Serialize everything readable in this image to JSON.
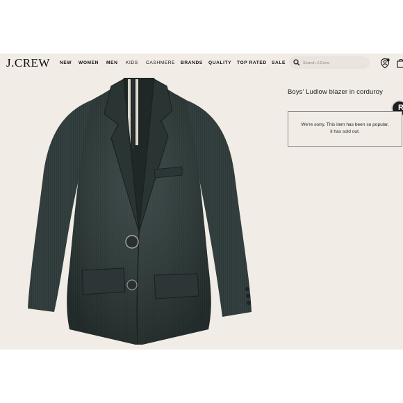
{
  "brand": {
    "logo": "J.CREW"
  },
  "nav": {
    "items": [
      {
        "label": "NEW"
      },
      {
        "label": "WOMEN"
      },
      {
        "label": "MEN"
      },
      {
        "label": "KIDS"
      },
      {
        "label": "CASHMERE"
      },
      {
        "label": "BRANDS"
      },
      {
        "label": "QUALITY"
      },
      {
        "label": "TOP RATED"
      },
      {
        "label": "SALE"
      }
    ]
  },
  "search": {
    "placeholder": "Search J.Crew",
    "value": ""
  },
  "icons": {
    "search": "search-icon",
    "account": "user-icon",
    "bag": "shopping-bag-icon"
  },
  "product": {
    "title": "Boys' Ludlow blazer in corduroy",
    "soldout_line1": "We're sorry. This item has been so popular,",
    "soldout_line2": "it has sold out.",
    "badge": "R",
    "image_description_colors": {
      "fabric": "#2f3a3b",
      "background": "#f1ede6"
    }
  }
}
